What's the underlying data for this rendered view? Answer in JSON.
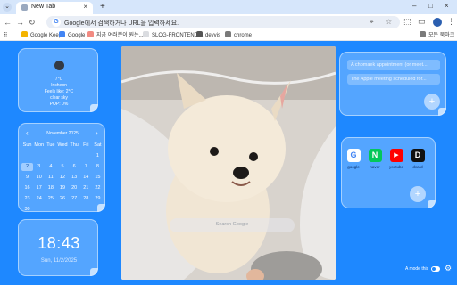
{
  "browser": {
    "tab_title": "New Tab",
    "tab_close": "×",
    "new_tab": "+",
    "window_controls": [
      "–",
      "□",
      "×"
    ],
    "omnibox_text": "Google에서 검색하거나 URL을 입력하세요.",
    "omnibox_icon": "G",
    "bookmarks": [
      {
        "label": "Google Keep",
        "color": "#f4b400"
      },
      {
        "label": "Google",
        "color": "#4285f4"
      },
      {
        "label": "지금 여러분이 원는...",
        "color": "#f28b82"
      },
      {
        "label": "SLOG-FRONTEND-...",
        "color": "#dadce0"
      },
      {
        "label": "devvis",
        "color": "#555555"
      },
      {
        "label": "chrome",
        "color": "#7a7a7a"
      }
    ],
    "all_bookmarks": "모든 북마크"
  },
  "weather": {
    "temp": "7°C",
    "city": "Incheon",
    "feels": "Feels like: 2°C",
    "condition": "clear sky",
    "pop": "POP: 0%"
  },
  "calendar": {
    "prev": "‹",
    "next": "›",
    "month": "November 2025",
    "weekdays": [
      "Sun",
      "Mon",
      "Tue",
      "Wed",
      "Thu",
      "Fri",
      "Sat"
    ],
    "days": [
      "",
      "",
      "",
      "",
      "",
      "",
      "1",
      "2",
      "3",
      "4",
      "5",
      "6",
      "7",
      "8",
      "9",
      "10",
      "11",
      "12",
      "13",
      "14",
      "15",
      "16",
      "17",
      "18",
      "19",
      "20",
      "21",
      "22",
      "23",
      "24",
      "25",
      "26",
      "27",
      "28",
      "29",
      "30"
    ],
    "today": "2"
  },
  "clock": {
    "time": "18:43",
    "date": "Sun, 11/2/2025"
  },
  "search": {
    "placeholder": "Search Google"
  },
  "todo": {
    "items": [
      "A chomaek appointment (or meet...",
      "The Apple meeting scheduled for..."
    ],
    "add": "+"
  },
  "apps": {
    "items": [
      {
        "label": "google",
        "glyph": "G",
        "color": "#4285f4",
        "bg": "#ffffff"
      },
      {
        "label": "naver",
        "glyph": "N",
        "color": "#ffffff",
        "bg": "#03c75a"
      },
      {
        "label": "youtube",
        "glyph": "▶",
        "color": "#ffffff",
        "bg": "#ff0000"
      },
      {
        "label": "dcard",
        "glyph": "D",
        "color": "#ffffff",
        "bg": "#111111"
      }
    ],
    "add": "+"
  },
  "footer": {
    "mode_label": "A mode this",
    "settings_icon": "⚙"
  }
}
